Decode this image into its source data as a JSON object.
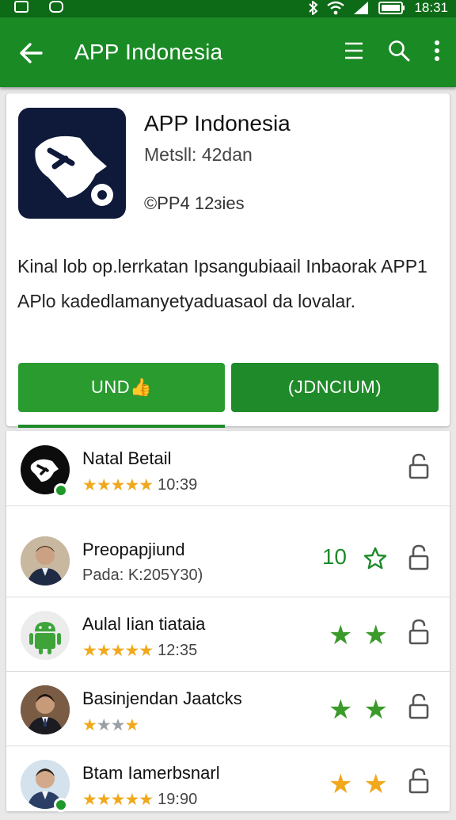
{
  "status": {
    "time": "18:31"
  },
  "appbar": {
    "title": "APP Indonesia"
  },
  "app": {
    "title": "APP Indonesia",
    "meta1": "Metsll: 42dan",
    "meta2": "©PP4 12ɜies",
    "desc_line1": "Kinal lob op.lerrkatan Ipsangubiaail Inbaorak APP1",
    "desc_line2": "APlo kadedlamanyetyaduasaol da lovalar.",
    "install_label": "UND👍",
    "open_label": "(JDNCIUM)"
  },
  "reviews": [
    {
      "name": "Natal Betail",
      "sub": "10:39",
      "stars": "★★★★★",
      "stars_off": ""
    },
    {
      "name": "Preopapjiund",
      "sub": "Pada: K:205Y30)",
      "rate": "10"
    },
    {
      "name": "Aulal Iian tiataia",
      "sub": "12:35",
      "stars": "★★★★★",
      "stars_off": ""
    },
    {
      "name": "Basinjendan Jaatcks",
      "sub": "",
      "stars": "★",
      "stars_off": "★★",
      "stars_tail": "★"
    },
    {
      "name": "Btam Iamerbsnarl",
      "sub": "19:90",
      "stars": "★★★★★",
      "stars_off": ""
    }
  ],
  "colors": {
    "primary": "#1a8a25",
    "star": "#f0a81c",
    "green_star": "#3a9a2a"
  },
  "icons": [
    "back-arrow-icon",
    "list-icon",
    "search-icon",
    "more-vert-icon",
    "lock-icon",
    "star-icon"
  ]
}
